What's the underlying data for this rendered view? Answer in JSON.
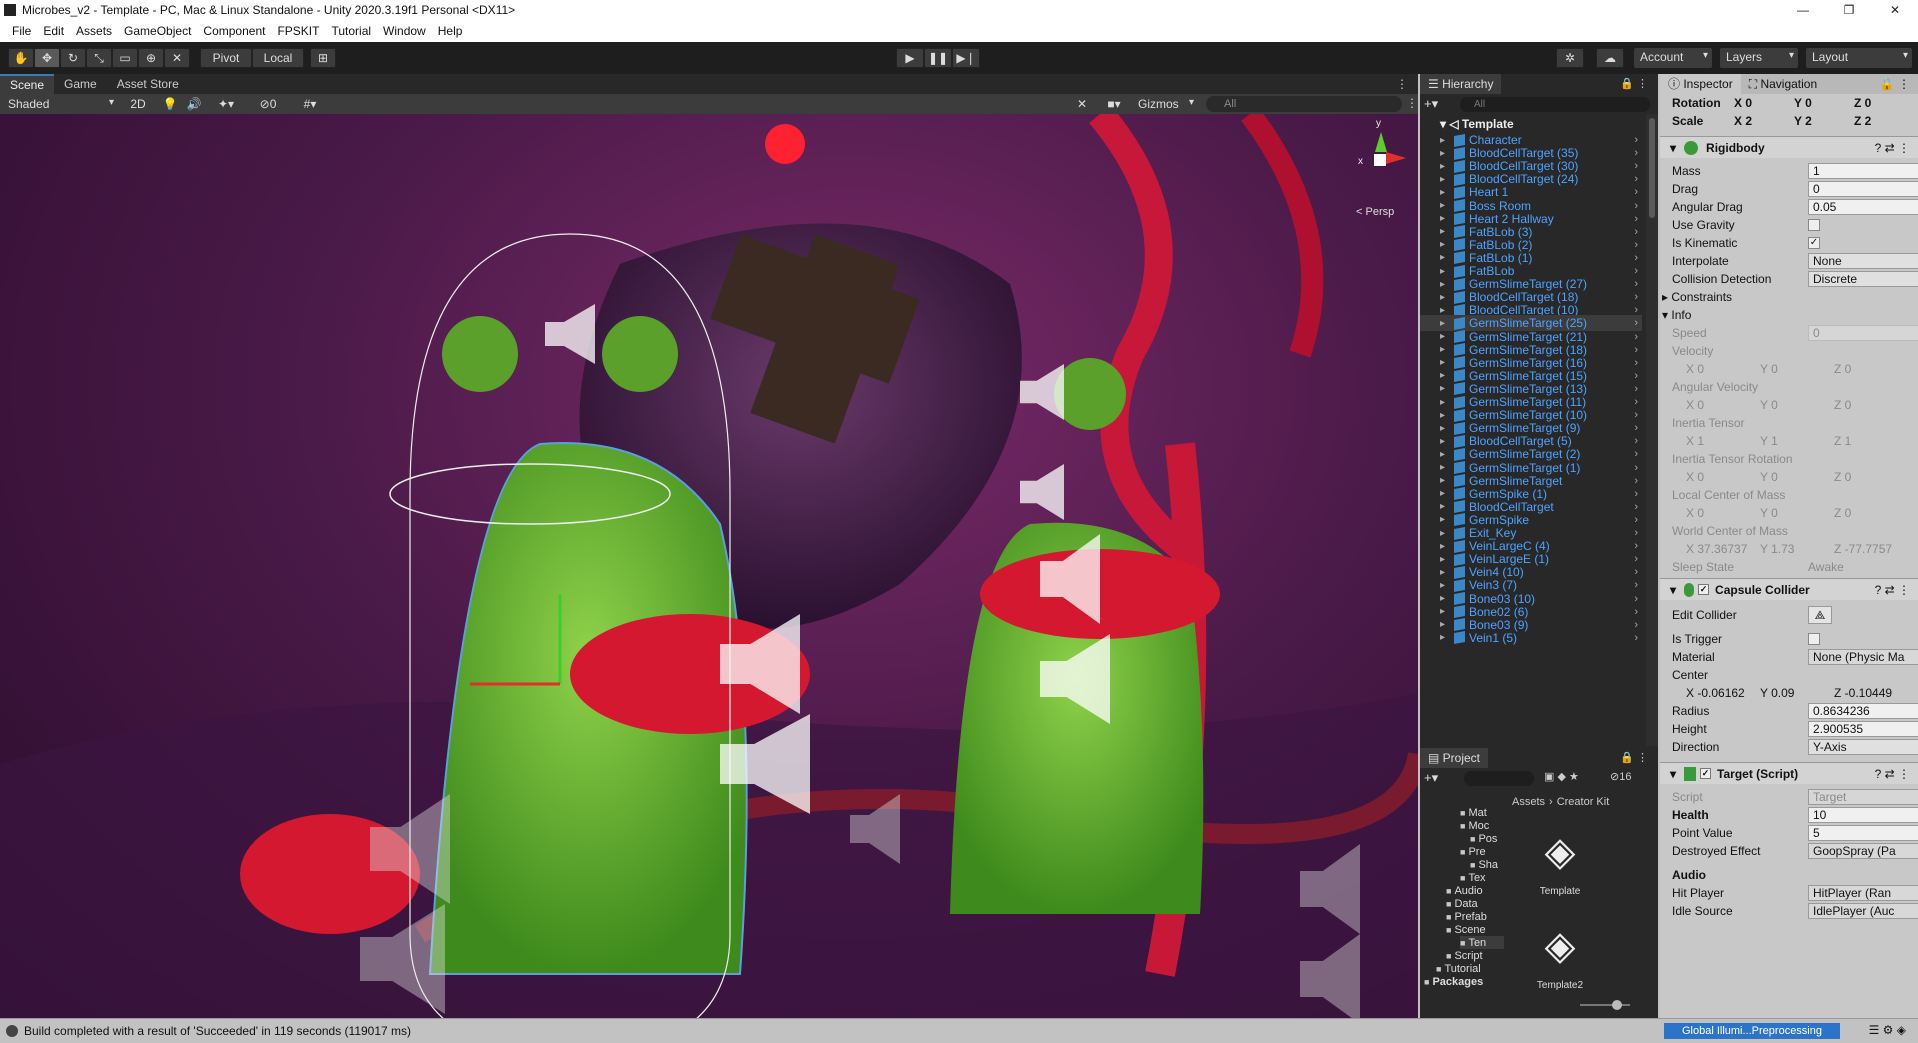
{
  "window": {
    "title": "Microbes_v2 - Template - PC, Mac & Linux Standalone - Unity 2020.3.19f1 Personal <DX11>"
  },
  "menu": [
    "File",
    "Edit",
    "Assets",
    "GameObject",
    "Component",
    "FPSKIT",
    "Tutorial",
    "Window",
    "Help"
  ],
  "toolbar": {
    "pivot": "Pivot",
    "local": "Local",
    "account": "Account",
    "layers": "Layers",
    "layout": "Layout"
  },
  "scene": {
    "tabs": [
      "Scene",
      "Game",
      "Asset Store"
    ],
    "shading": "Shaded",
    "mode2d": "2D",
    "hidden_count": "0",
    "gizmos": "Gizmos",
    "search_placeholder": "All",
    "persp": "Persp",
    "axis_y": "y",
    "axis_x": "x"
  },
  "hierarchy": {
    "tab": "Hierarchy",
    "search_placeholder": "All",
    "root": "Template",
    "items": [
      "Character",
      "BloodCellTarget (35)",
      "BloodCellTarget (30)",
      "BloodCellTarget (24)",
      "Heart 1",
      "Boss Room",
      "Heart 2 Hallway",
      "FatBLob (3)",
      "FatBLob (2)",
      "FatBLob (1)",
      "FatBLob",
      "GermSlimeTarget (27)",
      "BloodCellTarget (18)",
      "BloodCellTarget (10)",
      "GermSlimeTarget (25)",
      "GermSlimeTarget (21)",
      "GermSlimeTarget (18)",
      "GermSlimeTarget (16)",
      "GermSlimeTarget (15)",
      "GermSlimeTarget (13)",
      "GermSlimeTarget (11)",
      "GermSlimeTarget (10)",
      "GermSlimeTarget (9)",
      "BloodCellTarget (5)",
      "GermSlimeTarget (2)",
      "GermSlimeTarget (1)",
      "GermSlimeTarget",
      "GermSpike (1)",
      "BloodCellTarget",
      "GermSpike",
      "Exit_Key",
      "VeinLargeC (4)",
      "VeinLargeE (1)",
      "Vein4 (10)",
      "Vein3 (7)",
      "Bone03 (10)",
      "Bone02 (6)",
      "Bone03 (9)",
      "Vein1 (5)"
    ]
  },
  "project": {
    "tab": "Project",
    "hidden_count": "16",
    "breadcrumb": [
      "Assets",
      "Creator Kit"
    ],
    "tree": [
      "Mat",
      "Moc",
      "Pos",
      "Pre",
      "Sha",
      "Tex",
      "Audio",
      "Data",
      "Prefab",
      "Scene",
      "Ten",
      "Script",
      "Tutorial",
      "Packages"
    ],
    "assets": [
      "Template",
      "Template2"
    ]
  },
  "inspector": {
    "tabs": [
      "Inspector",
      "Navigation"
    ],
    "rotation": {
      "label": "Rotation",
      "x": "0",
      "y": "0",
      "z": "0"
    },
    "scale": {
      "label": "Scale",
      "x": "2",
      "y": "2",
      "z": "2"
    },
    "rigidbody": {
      "title": "Rigidbody",
      "fields": [
        {
          "label": "Mass",
          "value": "1"
        },
        {
          "label": "Drag",
          "value": "0"
        },
        {
          "label": "Angular Drag",
          "value": "0.05"
        }
      ],
      "use_gravity": "Use Gravity",
      "is_kinematic": "Is Kinematic",
      "interpolate": {
        "label": "Interpolate",
        "value": "None"
      },
      "collision": {
        "label": "Collision Detection",
        "value": "Discrete"
      },
      "constraints": "Constraints",
      "info": "Info",
      "speed": {
        "label": "Speed",
        "value": "0"
      },
      "velocity": {
        "label": "Velocity",
        "x": "0",
        "y": "0",
        "z": "0"
      },
      "angular_velocity": {
        "label": "Angular Velocity",
        "x": "0",
        "y": "0",
        "z": "0"
      },
      "inertia_tensor": {
        "label": "Inertia Tensor",
        "x": "1",
        "y": "1",
        "z": "1"
      },
      "inertia_rotation": {
        "label": "Inertia Tensor Rotation",
        "x": "0",
        "y": "0",
        "z": "0"
      },
      "local_com": {
        "label": "Local Center of Mass",
        "x": "0",
        "y": "0",
        "z": "0"
      },
      "world_com": {
        "label": "World Center of Mass",
        "x": "37.36737",
        "y": "1.73",
        "z": "-77.7757"
      },
      "sleep": {
        "label": "Sleep State",
        "value": "Awake"
      }
    },
    "capsule": {
      "title": "Capsule Collider",
      "edit": "Edit Collider",
      "trigger": "Is Trigger",
      "material": {
        "label": "Material",
        "value": "None (Physic Ma"
      },
      "center": {
        "label": "Center",
        "x": "-0.06162",
        "y": "0.09",
        "z": "-0.10449"
      },
      "radius": {
        "label": "Radius",
        "value": "0.8634236"
      },
      "height": {
        "label": "Height",
        "value": "2.900535"
      },
      "direction": {
        "label": "Direction",
        "value": "Y-Axis"
      }
    },
    "target": {
      "title": "Target (Script)",
      "script": {
        "label": "Script",
        "value": "Target"
      },
      "health": {
        "label": "Health",
        "value": "10"
      },
      "point": {
        "label": "Point Value",
        "value": "5"
      },
      "destroyed": {
        "label": "Destroyed Effect",
        "value": "GoopSpray (Pa"
      },
      "audio": "Audio",
      "hit": {
        "label": "Hit Player",
        "value": "HitPlayer (Ran"
      },
      "idle": {
        "label": "Idle Source",
        "value": "IdlePlayer (Auc"
      }
    }
  },
  "status": {
    "message": "Build completed with a result of 'Succeeded' in 119 seconds (119017 ms)",
    "progress": "Global Illumi...Preprocessing"
  }
}
